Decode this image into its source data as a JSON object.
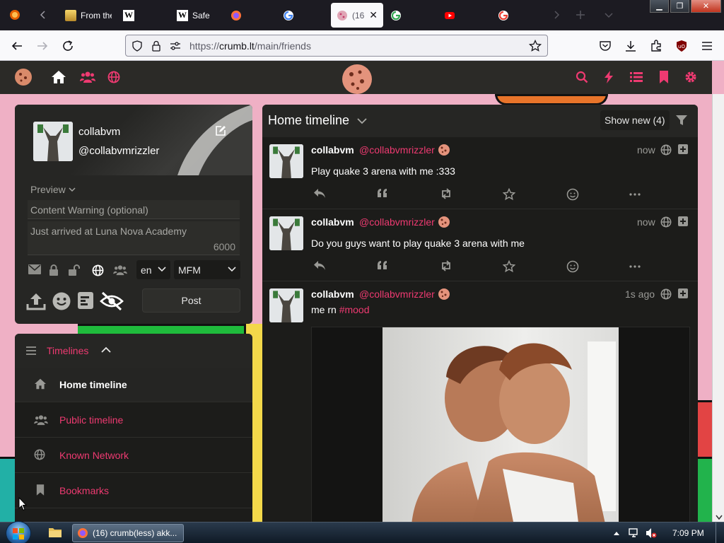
{
  "browser": {
    "tabs": [
      {
        "title": "",
        "favicon": "firefox-icon"
      },
      {
        "title": "From the",
        "favicon": "page-icon"
      },
      {
        "title": "",
        "favicon": "wikipedia-icon"
      },
      {
        "title": "Safe",
        "favicon": "wikipedia-icon"
      },
      {
        "title": "",
        "favicon": "firefox-icon"
      },
      {
        "title": "",
        "favicon": "google-icon"
      },
      {
        "title": "(16",
        "favicon": "cookie-icon",
        "active": true
      },
      {
        "title": "",
        "favicon": "google-icon"
      },
      {
        "title": "",
        "favicon": "youtube-icon"
      },
      {
        "title": "",
        "favicon": "google-icon"
      }
    ],
    "url": {
      "scheme": "https://",
      "host": "crumb.lt",
      "path": "/main/friends"
    }
  },
  "app": {
    "user": {
      "name": "collabvm",
      "handle": "@collabvmrizzler"
    },
    "composer": {
      "preview_label": "Preview",
      "cw_placeholder": "Content Warning (optional)",
      "post_placeholder": "Just arrived at Luna Nova Academy",
      "char_count": "6000",
      "language": "en",
      "format": "MFM",
      "post_label": "Post"
    },
    "nav": {
      "title": "Timelines",
      "items": [
        {
          "label": "Home timeline",
          "icon": "home-icon",
          "selected": true
        },
        {
          "label": "Public timeline",
          "icon": "users-icon"
        },
        {
          "label": "Known Network",
          "icon": "globe-icon"
        },
        {
          "label": "Bookmarks",
          "icon": "bookmark-icon"
        }
      ]
    },
    "timeline": {
      "title": "Home timeline",
      "show_new": "Show new (4)",
      "statuses": [
        {
          "name": "collabvm",
          "handle": "@collabvmrizzler",
          "time": "now",
          "text": "Play quake 3 arena with me :333"
        },
        {
          "name": "collabvm",
          "handle": "@collabvmrizzler",
          "time": "now",
          "text": "Do you guys want to play quake 3 arena with me"
        },
        {
          "name": "collabvm",
          "handle": "@collabvmrizzler",
          "time": "1s ago",
          "text": "me rn ",
          "hashtag": "#mood",
          "has_image": true
        }
      ]
    }
  },
  "taskbar": {
    "window_label": "(16) crumb(less) akk...",
    "clock": "7:09 PM"
  },
  "colors": {
    "accent": "#ee3a71",
    "panel": "#1e1e1c",
    "header": "#2b2a27",
    "page_bg": "#efb0c5"
  }
}
